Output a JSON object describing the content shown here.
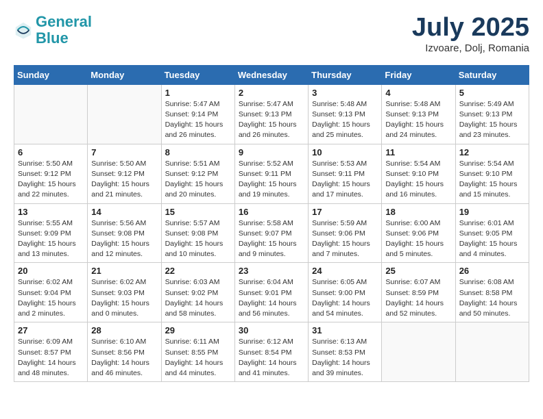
{
  "header": {
    "logo_line1": "General",
    "logo_line2": "Blue",
    "month": "July 2025",
    "location": "Izvoare, Dolj, Romania"
  },
  "days_of_week": [
    "Sunday",
    "Monday",
    "Tuesday",
    "Wednesday",
    "Thursday",
    "Friday",
    "Saturday"
  ],
  "weeks": [
    [
      {
        "day": "",
        "content": ""
      },
      {
        "day": "",
        "content": ""
      },
      {
        "day": "1",
        "content": "Sunrise: 5:47 AM\nSunset: 9:14 PM\nDaylight: 15 hours\nand 26 minutes."
      },
      {
        "day": "2",
        "content": "Sunrise: 5:47 AM\nSunset: 9:13 PM\nDaylight: 15 hours\nand 26 minutes."
      },
      {
        "day": "3",
        "content": "Sunrise: 5:48 AM\nSunset: 9:13 PM\nDaylight: 15 hours\nand 25 minutes."
      },
      {
        "day": "4",
        "content": "Sunrise: 5:48 AM\nSunset: 9:13 PM\nDaylight: 15 hours\nand 24 minutes."
      },
      {
        "day": "5",
        "content": "Sunrise: 5:49 AM\nSunset: 9:13 PM\nDaylight: 15 hours\nand 23 minutes."
      }
    ],
    [
      {
        "day": "6",
        "content": "Sunrise: 5:50 AM\nSunset: 9:12 PM\nDaylight: 15 hours\nand 22 minutes."
      },
      {
        "day": "7",
        "content": "Sunrise: 5:50 AM\nSunset: 9:12 PM\nDaylight: 15 hours\nand 21 minutes."
      },
      {
        "day": "8",
        "content": "Sunrise: 5:51 AM\nSunset: 9:12 PM\nDaylight: 15 hours\nand 20 minutes."
      },
      {
        "day": "9",
        "content": "Sunrise: 5:52 AM\nSunset: 9:11 PM\nDaylight: 15 hours\nand 19 minutes."
      },
      {
        "day": "10",
        "content": "Sunrise: 5:53 AM\nSunset: 9:11 PM\nDaylight: 15 hours\nand 17 minutes."
      },
      {
        "day": "11",
        "content": "Sunrise: 5:54 AM\nSunset: 9:10 PM\nDaylight: 15 hours\nand 16 minutes."
      },
      {
        "day": "12",
        "content": "Sunrise: 5:54 AM\nSunset: 9:10 PM\nDaylight: 15 hours\nand 15 minutes."
      }
    ],
    [
      {
        "day": "13",
        "content": "Sunrise: 5:55 AM\nSunset: 9:09 PM\nDaylight: 15 hours\nand 13 minutes."
      },
      {
        "day": "14",
        "content": "Sunrise: 5:56 AM\nSunset: 9:08 PM\nDaylight: 15 hours\nand 12 minutes."
      },
      {
        "day": "15",
        "content": "Sunrise: 5:57 AM\nSunset: 9:08 PM\nDaylight: 15 hours\nand 10 minutes."
      },
      {
        "day": "16",
        "content": "Sunrise: 5:58 AM\nSunset: 9:07 PM\nDaylight: 15 hours\nand 9 minutes."
      },
      {
        "day": "17",
        "content": "Sunrise: 5:59 AM\nSunset: 9:06 PM\nDaylight: 15 hours\nand 7 minutes."
      },
      {
        "day": "18",
        "content": "Sunrise: 6:00 AM\nSunset: 9:06 PM\nDaylight: 15 hours\nand 5 minutes."
      },
      {
        "day": "19",
        "content": "Sunrise: 6:01 AM\nSunset: 9:05 PM\nDaylight: 15 hours\nand 4 minutes."
      }
    ],
    [
      {
        "day": "20",
        "content": "Sunrise: 6:02 AM\nSunset: 9:04 PM\nDaylight: 15 hours\nand 2 minutes."
      },
      {
        "day": "21",
        "content": "Sunrise: 6:02 AM\nSunset: 9:03 PM\nDaylight: 15 hours\nand 0 minutes."
      },
      {
        "day": "22",
        "content": "Sunrise: 6:03 AM\nSunset: 9:02 PM\nDaylight: 14 hours\nand 58 minutes."
      },
      {
        "day": "23",
        "content": "Sunrise: 6:04 AM\nSunset: 9:01 PM\nDaylight: 14 hours\nand 56 minutes."
      },
      {
        "day": "24",
        "content": "Sunrise: 6:05 AM\nSunset: 9:00 PM\nDaylight: 14 hours\nand 54 minutes."
      },
      {
        "day": "25",
        "content": "Sunrise: 6:07 AM\nSunset: 8:59 PM\nDaylight: 14 hours\nand 52 minutes."
      },
      {
        "day": "26",
        "content": "Sunrise: 6:08 AM\nSunset: 8:58 PM\nDaylight: 14 hours\nand 50 minutes."
      }
    ],
    [
      {
        "day": "27",
        "content": "Sunrise: 6:09 AM\nSunset: 8:57 PM\nDaylight: 14 hours\nand 48 minutes."
      },
      {
        "day": "28",
        "content": "Sunrise: 6:10 AM\nSunset: 8:56 PM\nDaylight: 14 hours\nand 46 minutes."
      },
      {
        "day": "29",
        "content": "Sunrise: 6:11 AM\nSunset: 8:55 PM\nDaylight: 14 hours\nand 44 minutes."
      },
      {
        "day": "30",
        "content": "Sunrise: 6:12 AM\nSunset: 8:54 PM\nDaylight: 14 hours\nand 41 minutes."
      },
      {
        "day": "31",
        "content": "Sunrise: 6:13 AM\nSunset: 8:53 PM\nDaylight: 14 hours\nand 39 minutes."
      },
      {
        "day": "",
        "content": ""
      },
      {
        "day": "",
        "content": ""
      }
    ]
  ]
}
